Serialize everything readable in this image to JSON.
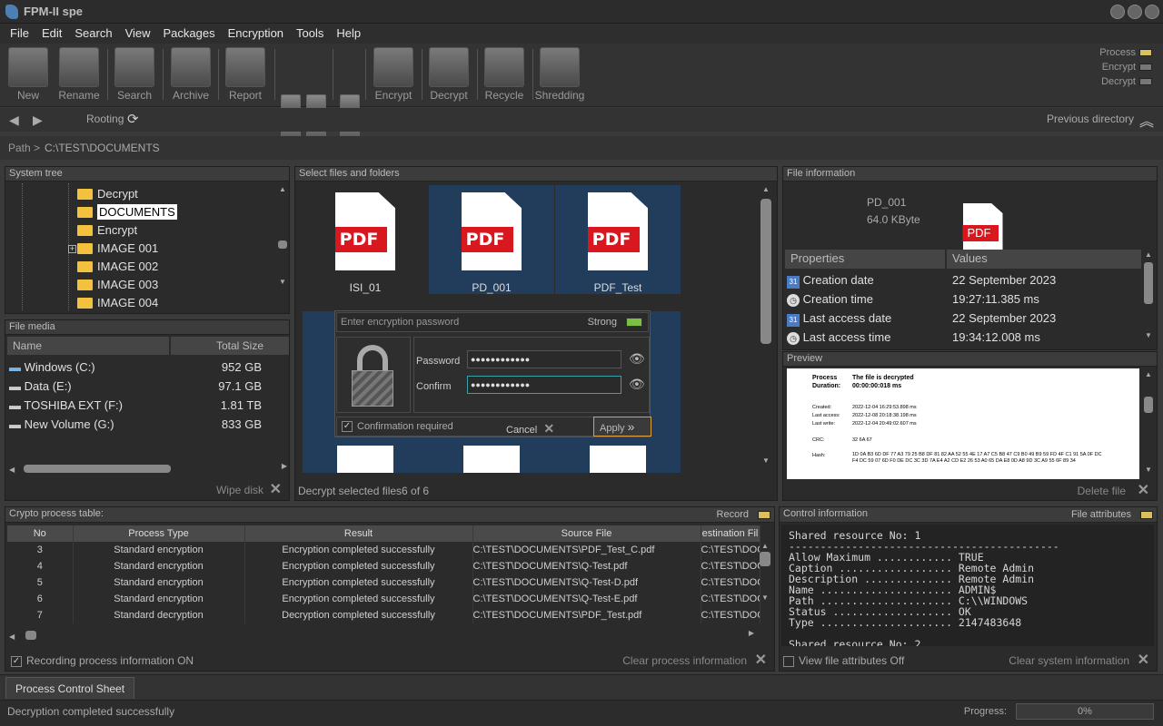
{
  "window": {
    "title": "FPM-II spe"
  },
  "menu": [
    "File",
    "Edit",
    "Search",
    "View",
    "Packages",
    "Encryption",
    "Tools",
    "Help"
  ],
  "toolbar": {
    "new": "New",
    "rename": "Rename",
    "search": "Search",
    "archive": "Archive",
    "report": "Report",
    "encrypt": "Encrypt",
    "decrypt": "Decrypt",
    "recycle": "Recycle",
    "shredding": "Shredding"
  },
  "indicators": {
    "process": "Process",
    "encrypt": "Encrypt",
    "decrypt": "Decrypt",
    "process_color": "#d8c060",
    "off_color": "#777777"
  },
  "nav": {
    "rooting": "Rooting",
    "previous": "Previous directory"
  },
  "path": {
    "label": "Path >",
    "value": "C:\\TEST\\DOCUMENTS"
  },
  "system_tree": {
    "title": "System tree",
    "items": [
      "Decrypt",
      "DOCUMENTS",
      "Encrypt",
      "IMAGE 001",
      "IMAGE 002",
      "IMAGE 003",
      "IMAGE 004"
    ]
  },
  "file_media": {
    "title": "File media",
    "col_name": "Name",
    "col_size": "Total Size",
    "rows": [
      {
        "name": "Windows  (C:)",
        "size": "952 GB"
      },
      {
        "name": "Data (E:)",
        "size": "97.1 GB"
      },
      {
        "name": "TOSHIBA EXT (F:)",
        "size": "1.81 TB"
      },
      {
        "name": "New Volume (G:)",
        "size": "833 GB"
      }
    ],
    "wipe": "Wipe disk"
  },
  "files": {
    "title": "Select files and folders",
    "tiles": [
      {
        "name": "ISI_01"
      },
      {
        "name": "PD_001"
      },
      {
        "name": "PDF_Test"
      }
    ],
    "pdf_label": "PDF",
    "footer": "Decrypt selected files6 of 6"
  },
  "dialog": {
    "placeholder": "Enter encryption password",
    "strength": "Strong",
    "password_label": "Password",
    "confirm_label": "Confirm",
    "password_value": "●●●●●●●●●●●●",
    "confirm_value": "●●●●●●●●●●●●",
    "confirmation": "Confirmation required",
    "cancel": "Cancel",
    "apply": "Apply"
  },
  "file_info": {
    "title": "File information",
    "name": "PD_001",
    "size": "64.0 KByte",
    "col_props": "Properties",
    "col_values": "Values",
    "props": [
      {
        "k": "Creation date",
        "v": "22 September 2023"
      },
      {
        "k": "Creation time",
        "v": "19:27:11.385 ms"
      },
      {
        "k": "Last access date",
        "v": "22 September 2023"
      },
      {
        "k": "Last access time",
        "v": "19:34:12.008 ms"
      }
    ],
    "preview_title": "Preview",
    "delete": "Delete file"
  },
  "preview": {
    "process": "Process",
    "process_val": "The file is decrypted",
    "duration": "Duration:",
    "duration_val": "00:00:00:018 ms",
    "created": "Created:",
    "created_val": "2022-12-04 16:29:53.898 ms",
    "last_access": "Last access:",
    "last_access_val": "2022-12-08 20:18:38.198 ms",
    "last_write": "Last write:",
    "last_write_val": "2022-12-04 20:49:02.607 ms",
    "crc": "CRC:",
    "crc_val": "32 6A 67",
    "hash": "Hash:",
    "hash_val": "1D 0A B3 6D DF 77 A3 79 25 B8 DF 81 82 AA 52 55 4E 17 A7 C5 B8 47 C9 B0 49 B9 59 FD 4F C1 91 5A 0F DC F4 DC 59 07 6D F0 DE DC 3C 3D 7A E4 A2 CD E2 26 53 A0 65 DA E8 0D A8 9D 3C A9 55 6F 89 34"
  },
  "crypto": {
    "title": "Crypto process table:",
    "record": "Record",
    "cols": [
      "No",
      "Process Type",
      "Result",
      "Source File",
      "estination Fil"
    ],
    "rows": [
      [
        "3",
        "Standard encryption",
        "Encryption completed successfully",
        "C:\\TEST\\DOCUMENTS\\PDF_Test_C.pdf",
        "C:\\TEST\\DOC"
      ],
      [
        "4",
        "Standard encryption",
        "Encryption completed successfully",
        "C:\\TEST\\DOCUMENTS\\Q-Test.pdf",
        "C:\\TEST\\DOC"
      ],
      [
        "5",
        "Standard encryption",
        "Encryption completed successfully",
        "C:\\TEST\\DOCUMENTS\\Q-Test-D.pdf",
        "C:\\TEST\\DOC"
      ],
      [
        "6",
        "Standard encryption",
        "Encryption completed successfully",
        "C:\\TEST\\DOCUMENTS\\Q-Test-E.pdf",
        "C:\\TEST\\DOC"
      ],
      [
        "7",
        "Standard decryption",
        "Decryption completed successfully",
        "C:\\TEST\\DOCUMENTS\\PDF_Test.pdf",
        "C:\\TEST\\DOC"
      ]
    ],
    "recording": "Recording process information ON",
    "clear": "Clear process information"
  },
  "control": {
    "title": "Control information",
    "attrs": "File attributes",
    "text": "Shared resource No: 1\n-------------------------------------------\nAllow Maximum ............ TRUE\nCaption .................. Remote Admin\nDescription .............. Remote Admin\nName ..................... ADMIN$\nPath ..................... C:\\\\WINDOWS\nStatus ................... OK\nType ..................... 2147483648\n\nShared resource No: 2",
    "view_attrs": "View file attributes Off",
    "clear": "Clear system information"
  },
  "tab": "Process Control Sheet",
  "status": {
    "text": "Decryption completed successfully",
    "progress_label": "Progress:",
    "progress": "0%"
  }
}
